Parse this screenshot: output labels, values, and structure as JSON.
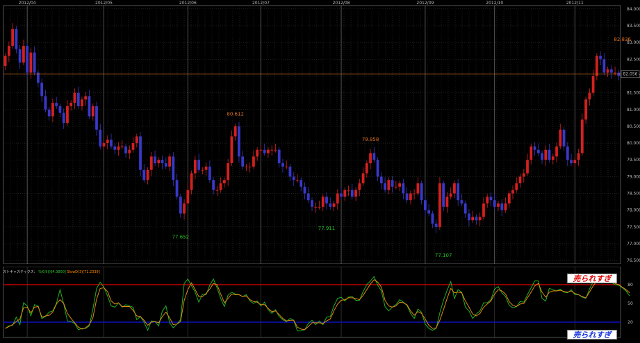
{
  "colors": {
    "up": "#d42020",
    "down": "#3838c8",
    "k": "#22b022",
    "d": "#e08a10",
    "current": "#e07020",
    "overbought": "#c00000",
    "oversold": "#1010c0",
    "grid": "#3a3a3a"
  },
  "chart_data": [
    {
      "type": "candlestick",
      "title": "",
      "months": [
        {
          "label": "2012/04",
          "index": 6
        },
        {
          "label": "2012/05",
          "index": 27
        },
        {
          "label": "2012/06",
          "index": 50
        },
        {
          "label": "2012/07",
          "index": 70
        },
        {
          "label": "2012/08",
          "index": 92
        },
        {
          "label": "2012/09",
          "index": 115
        },
        {
          "label": "2012/10",
          "index": 134
        },
        {
          "label": "2012/11",
          "index": 156
        }
      ],
      "y_ticks": [
        "76.500",
        "77.000",
        "77.500",
        "78.000",
        "78.500",
        "79.000",
        "79.500",
        "80.000",
        "80.500",
        "81.000",
        "81.500",
        "82.000",
        "82.500",
        "83.000",
        "83.500",
        "84.000"
      ],
      "ylim": [
        76.4,
        84.1
      ],
      "ytick_values": [
        76.5,
        77,
        77.5,
        78,
        78.5,
        79,
        79.5,
        80,
        80.5,
        81,
        81.5,
        82,
        82.5,
        83,
        83.5,
        84
      ],
      "current_price": 82.056,
      "current_label": "82.056",
      "annotations": [
        {
          "text": "82.836",
          "index": 169,
          "price": 82.836,
          "pos": "above"
        },
        {
          "text": "80.612",
          "index": 63,
          "price": 80.612,
          "pos": "above"
        },
        {
          "text": "79.858",
          "index": 100,
          "price": 79.858,
          "pos": "above"
        },
        {
          "text": "77.652",
          "index": 48,
          "price": 77.652,
          "pos": "below"
        },
        {
          "text": "77.911",
          "index": 88,
          "price": 77.911,
          "pos": "below"
        },
        {
          "text": "77.107",
          "index": 120,
          "price": 77.107,
          "pos": "below"
        }
      ],
      "closes": [
        82.6,
        82.9,
        83.4,
        82.8,
        82.4,
        82.9,
        82.1,
        82.7,
        82.1,
        81.8,
        81.4,
        81.0,
        80.8,
        81.2,
        81.1,
        80.9,
        80.6,
        81.1,
        81.2,
        81.5,
        81.1,
        81.3,
        81.4,
        80.8,
        81.1,
        80.4,
        79.9,
        80.0,
        80.1,
        79.9,
        79.8,
        79.9,
        79.9,
        79.7,
        79.8,
        80.0,
        80.2,
        79.2,
        78.9,
        79.2,
        79.6,
        79.4,
        79.5,
        79.4,
        79.3,
        79.6,
        78.9,
        78.4,
        77.9,
        78.2,
        78.6,
        79.1,
        79.5,
        79.2,
        79.2,
        79.3,
        78.9,
        78.6,
        78.6,
        78.8,
        78.9,
        79.4,
        80.2,
        80.5,
        79.6,
        79.3,
        79.3,
        79.3,
        79.6,
        79.8,
        79.8,
        79.7,
        79.8,
        79.8,
        79.8,
        79.4,
        79.3,
        79.3,
        79.0,
        78.9,
        78.9,
        78.7,
        78.5,
        78.3,
        78.1,
        78.1,
        78.1,
        78.4,
        78.2,
        78.1,
        78.2,
        78.5,
        78.4,
        78.6,
        78.6,
        78.4,
        78.6,
        78.8,
        79.1,
        79.4,
        79.7,
        79.5,
        79.0,
        78.8,
        78.6,
        78.9,
        78.7,
        78.7,
        78.8,
        78.5,
        78.3,
        78.5,
        78.5,
        78.8,
        78.3,
        78.0,
        77.9,
        77.6,
        77.5,
        78.8,
        78.1,
        78.4,
        78.5,
        78.8,
        78.3,
        78.2,
        77.9,
        77.7,
        77.8,
        77.7,
        77.8,
        78.2,
        78.4,
        78.3,
        78.1,
        78.2,
        78.0,
        78.2,
        78.5,
        78.6,
        78.8,
        79.0,
        79.1,
        79.5,
        79.9,
        79.8,
        79.7,
        79.5,
        79.8,
        79.5,
        79.6,
        79.9,
        80.4,
        79.9,
        79.5,
        79.4,
        79.5,
        79.7,
        80.7,
        81.3,
        81.5,
        82.0,
        82.6,
        82.5,
        82.1,
        82.2,
        82.1,
        82.1,
        82.0
      ]
    },
    {
      "type": "line",
      "title": "",
      "legend_text": "ストキャスティクス：",
      "legend_k": "%K(9)[64.3800]",
      "legend_d": "SlowD(3)[71.2339]",
      "ylim": [
        0,
        100
      ],
      "y_ticks": [
        "20",
        "50",
        "80"
      ],
      "ytick_values": [
        20,
        50,
        80
      ],
      "overbought": 80,
      "oversold": 20,
      "overbought_label": "売られすぎ",
      "oversold_label": "売られすぎ",
      "series": [
        {
          "name": "%K(9)",
          "values": [
            10,
            14,
            15,
            28,
            16,
            51,
            46,
            30,
            48,
            46,
            26,
            29,
            36,
            38,
            50,
            72,
            49,
            22,
            21,
            18,
            8,
            10,
            10,
            14,
            41,
            74,
            84,
            76,
            62,
            46,
            44,
            51,
            44,
            48,
            46,
            44,
            24,
            29,
            20,
            7,
            22,
            21,
            14,
            38,
            46,
            19,
            11,
            17,
            24,
            82,
            89,
            78,
            68,
            52,
            65,
            64,
            79,
            89,
            75,
            58,
            45,
            63,
            68,
            65,
            64,
            61,
            64,
            54,
            50,
            54,
            46,
            52,
            40,
            34,
            40,
            29,
            24,
            21,
            26,
            23,
            6,
            6,
            8,
            18,
            23,
            16,
            22,
            16,
            28,
            29,
            46,
            58,
            60,
            54,
            60,
            61,
            55,
            55,
            69,
            80,
            86,
            93,
            79,
            70,
            45,
            38,
            44,
            48,
            56,
            52,
            47,
            34,
            26,
            41,
            36,
            17,
            10,
            7,
            10,
            35,
            55,
            71,
            85,
            58,
            72,
            68,
            44,
            38,
            26,
            33,
            38,
            51,
            51,
            56,
            73,
            77,
            67,
            61,
            47,
            43,
            45,
            53,
            52,
            64,
            75,
            86,
            86,
            58,
            54,
            74,
            72,
            70,
            73,
            68,
            67,
            72,
            64,
            64,
            60,
            58,
            73,
            85,
            90,
            96,
            94,
            88,
            84,
            80,
            79,
            75,
            70,
            62
          ]
        },
        {
          "name": "SlowD(3)",
          "values": [
            10,
            13,
            16,
            21,
            25,
            43,
            44,
            35,
            44,
            45,
            28,
            30,
            31,
            36,
            49,
            56,
            50,
            34,
            26,
            19,
            12,
            9,
            11,
            16,
            27,
            57,
            74,
            75,
            69,
            54,
            49,
            51,
            45,
            45,
            45,
            39,
            30,
            29,
            23,
            15,
            20,
            21,
            19,
            29,
            36,
            27,
            16,
            17,
            21,
            55,
            72,
            83,
            72,
            61,
            61,
            66,
            73,
            82,
            80,
            65,
            51,
            58,
            65,
            64,
            64,
            61,
            62,
            56,
            53,
            52,
            48,
            48,
            42,
            37,
            38,
            32,
            26,
            22,
            23,
            23,
            12,
            9,
            8,
            13,
            19,
            19,
            19,
            18,
            22,
            25,
            38,
            49,
            55,
            56,
            59,
            59,
            58,
            56,
            63,
            72,
            81,
            88,
            84,
            76,
            55,
            46,
            44,
            46,
            52,
            51,
            48,
            38,
            31,
            37,
            34,
            25,
            15,
            10,
            11,
            23,
            40,
            58,
            74,
            67,
            68,
            67,
            54,
            44,
            33,
            30,
            34,
            44,
            49,
            54,
            65,
            72,
            70,
            65,
            53,
            47,
            45,
            49,
            50,
            59,
            68,
            78,
            82,
            68,
            60,
            68,
            70,
            70,
            71,
            69,
            68,
            70,
            66,
            64,
            61,
            59,
            68,
            78,
            86,
            92,
            93,
            90,
            86,
            82,
            80,
            76,
            72,
            67
          ]
        }
      ]
    }
  ]
}
